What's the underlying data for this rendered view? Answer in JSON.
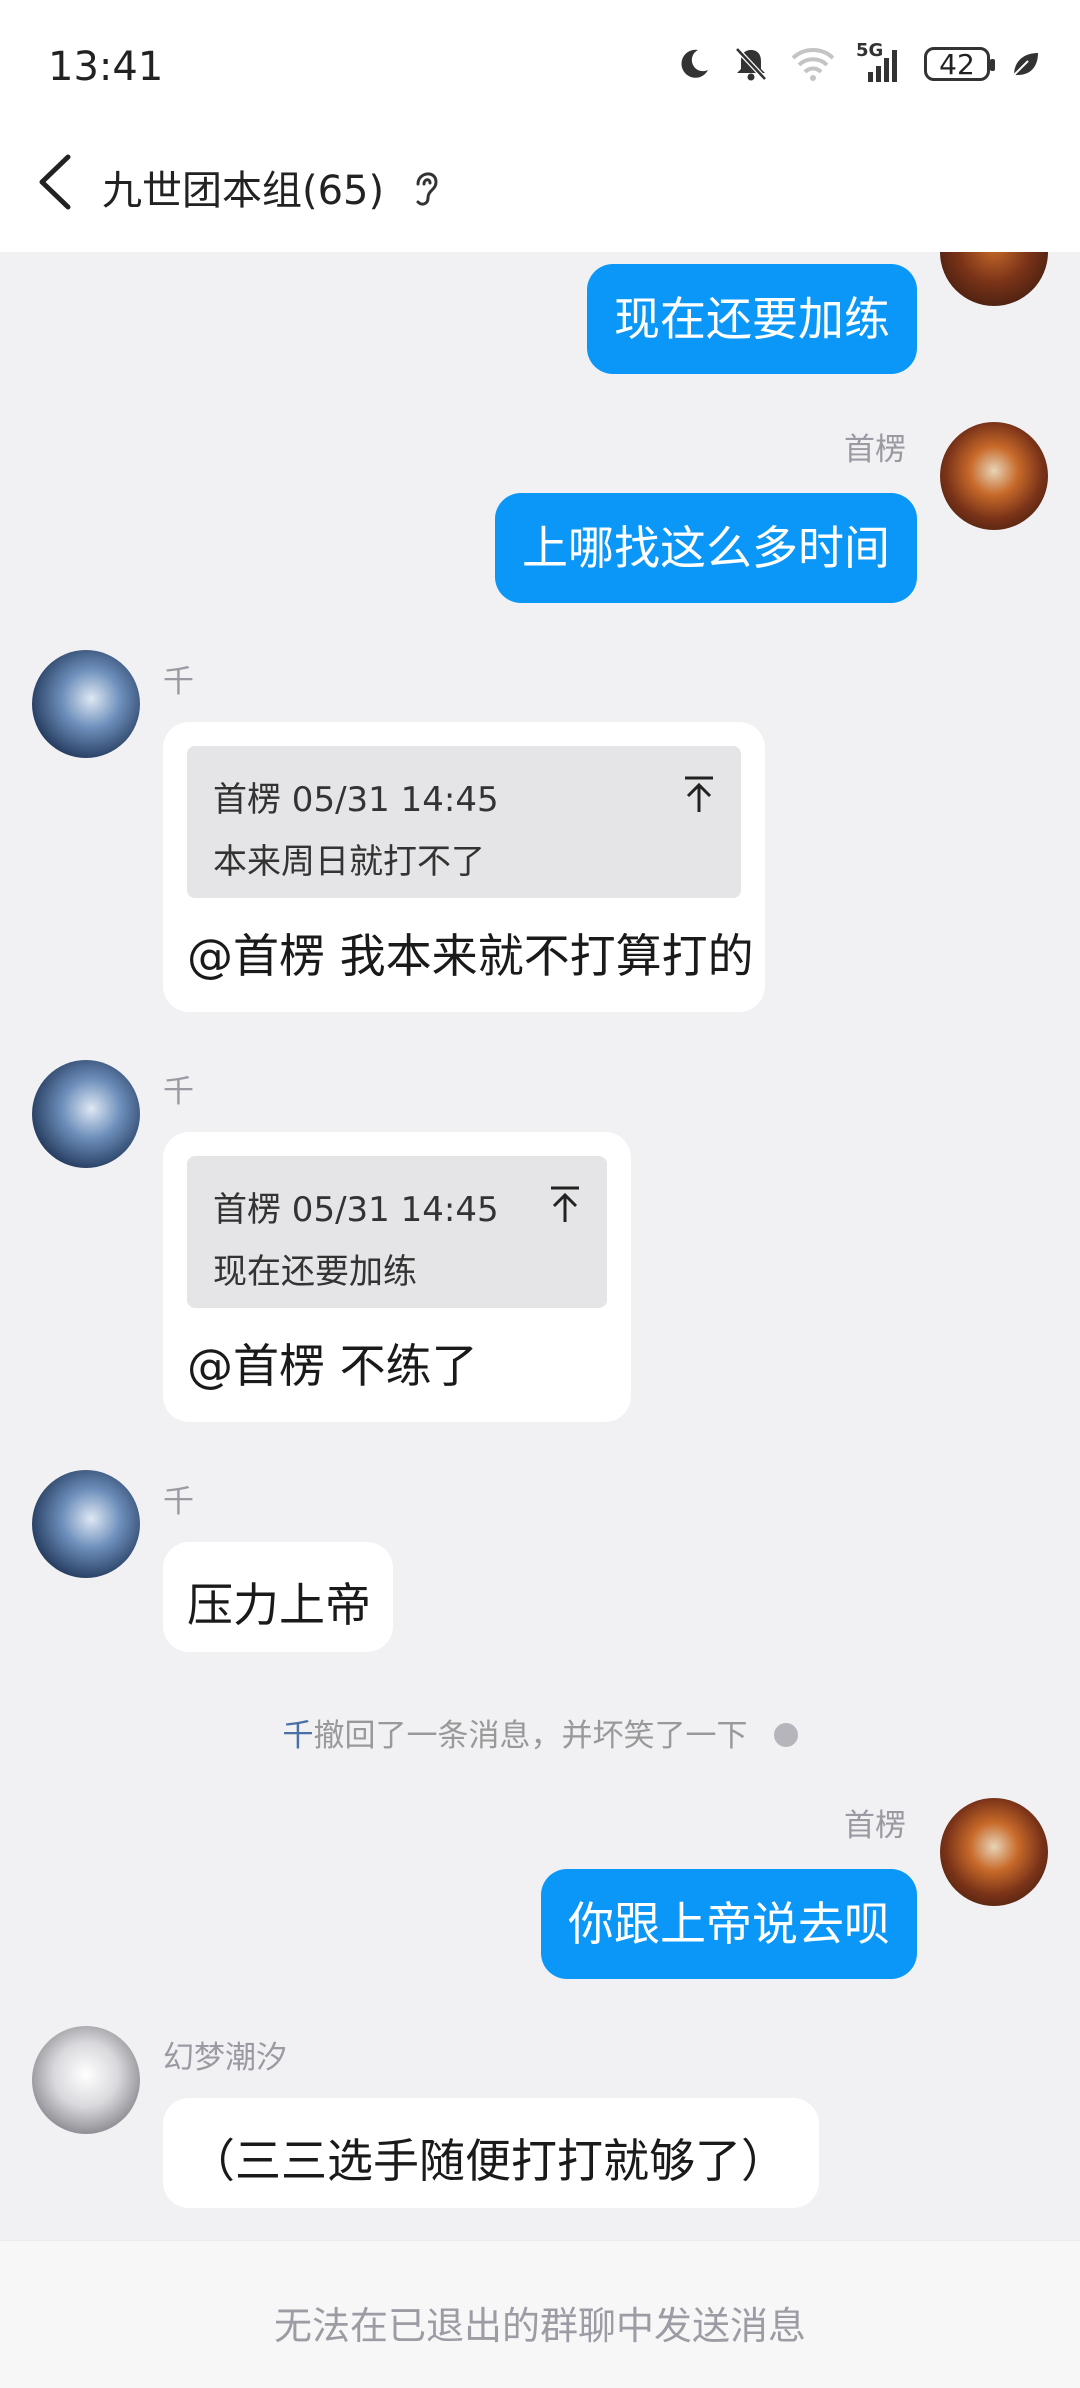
{
  "status_bar": {
    "time": "13:41",
    "network": "5G",
    "battery": "42",
    "icons": [
      "moon-icon",
      "bell-off-icon",
      "wifi-icon",
      "signal-icon",
      "battery-icon",
      "leaf-icon"
    ]
  },
  "header": {
    "title": "九世团本组(65)",
    "back_icon": "chevron-left-icon",
    "ear_icon": "ear-icon"
  },
  "messages": [
    {
      "direction": "out",
      "text": "现在还要加练"
    },
    {
      "direction": "out",
      "sender": "首楞",
      "text": "上哪找这么多时间"
    },
    {
      "direction": "in",
      "sender": "千",
      "quote": {
        "header": "首楞 05/31 14:45",
        "text": "本来周日就打不了"
      },
      "text": "@首楞 我本来就不打算打的"
    },
    {
      "direction": "in",
      "sender": "千",
      "quote": {
        "header": "首楞 05/31 14:45",
        "text": "现在还要加练"
      },
      "text": "@首楞 不练了"
    },
    {
      "direction": "in",
      "sender": "千",
      "text": "压力上帝"
    },
    {
      "direction": "out",
      "sender": "首楞",
      "text": "你跟上帝说去呗"
    },
    {
      "direction": "in",
      "sender": "幻梦潮汐",
      "text": "（三三选手随便打打就够了）"
    }
  ],
  "recall_notice": {
    "name": "千",
    "text": "撤回了一条消息，并坏笑了一下"
  },
  "footer": {
    "notice": "无法在已退出的群聊中发送消息"
  },
  "colors": {
    "accent": "#0b97f7",
    "background": "#f1f1f4"
  }
}
